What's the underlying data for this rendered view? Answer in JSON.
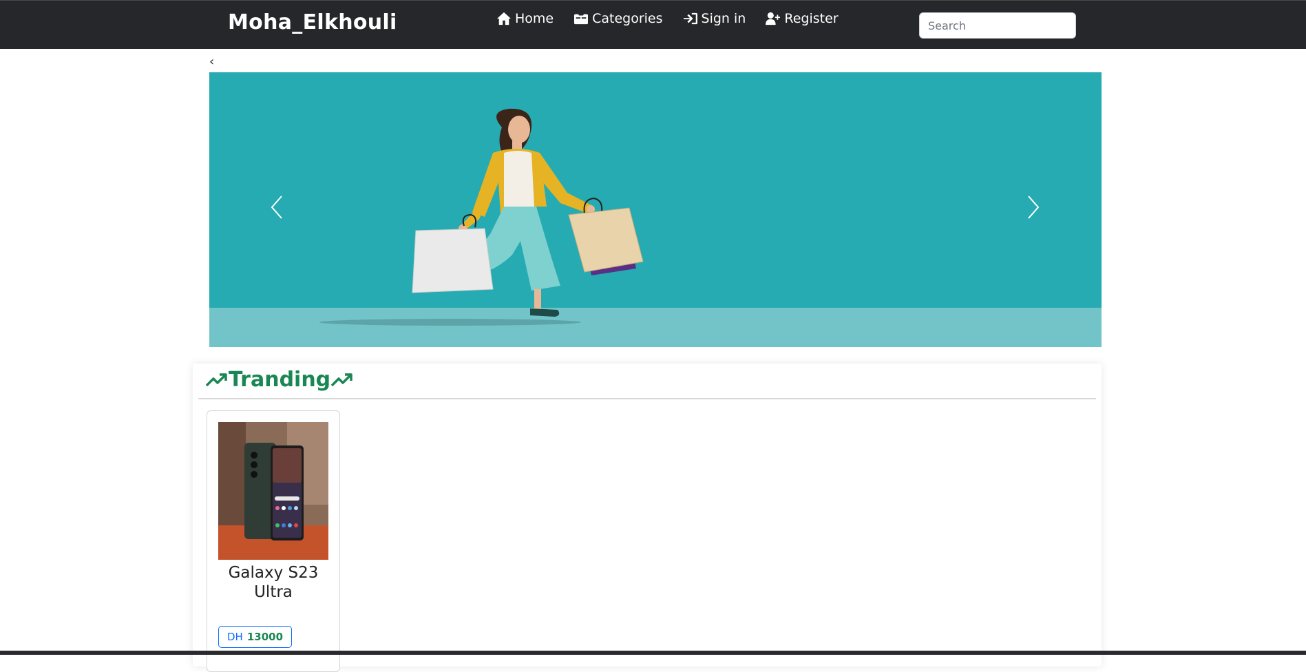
{
  "navbar": {
    "brand": "Moha_Elkhouli",
    "links": [
      {
        "label": "Home",
        "icon": "home-icon"
      },
      {
        "label": "Categories",
        "icon": "categories-icon"
      },
      {
        "label": "Sign in",
        "icon": "sign-in-icon"
      },
      {
        "label": "Register",
        "icon": "user-plus-icon"
      }
    ],
    "search_placeholder": "Search",
    "search_value": ""
  },
  "back": {
    "glyph": "‹"
  },
  "carousel": {
    "icons": {
      "prev": "chevron-left-icon",
      "next": "chevron-right-icon"
    },
    "colors": {
      "background": "#27abb3",
      "floor": "#72c4c9"
    }
  },
  "trending": {
    "title": "Tranding",
    "icon": "trending-up-icon",
    "color": "#198754",
    "products": [
      {
        "name": "Galaxy S23 Ultra",
        "currency": "DH",
        "price": "13000"
      }
    ]
  }
}
